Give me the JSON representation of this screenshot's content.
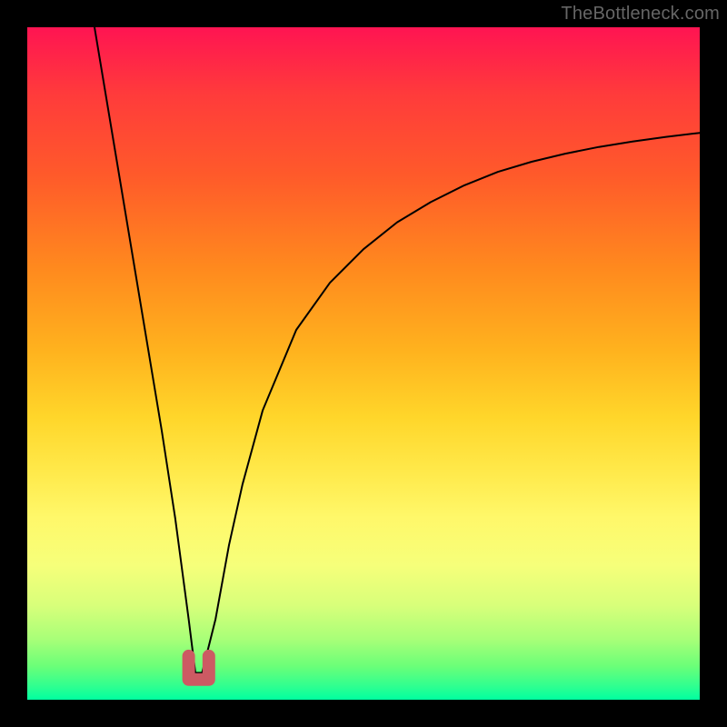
{
  "watermark": "TheBottleneck.com",
  "colors": {
    "curve_stroke": "#000000",
    "bracket_stroke": "#cc5a63"
  },
  "chart_data": {
    "type": "line",
    "title": "",
    "xlabel": "",
    "ylabel": "",
    "xlim": [
      0,
      100
    ],
    "ylim": [
      0,
      100
    ],
    "grid": false,
    "legend": false,
    "series": [
      {
        "name": "bottleneck-curve",
        "x": [
          10,
          12,
          14,
          16,
          18,
          20,
          22,
          24,
          25,
          26,
          28,
          30,
          32,
          35,
          40,
          45,
          50,
          55,
          60,
          65,
          70,
          75,
          80,
          85,
          90,
          95,
          100
        ],
        "y": [
          100,
          88,
          76,
          64,
          52,
          40,
          27,
          12,
          4,
          4,
          12,
          23,
          32,
          43,
          55,
          62,
          67,
          71,
          74,
          76.5,
          78.5,
          80,
          81.2,
          82.2,
          83,
          83.7,
          84.3
        ]
      }
    ],
    "annotations": [
      {
        "name": "optimal-range-bracket",
        "x_range": [
          24,
          27
        ],
        "y": 3
      }
    ],
    "background_gradient": "rainbow-red-to-green"
  }
}
